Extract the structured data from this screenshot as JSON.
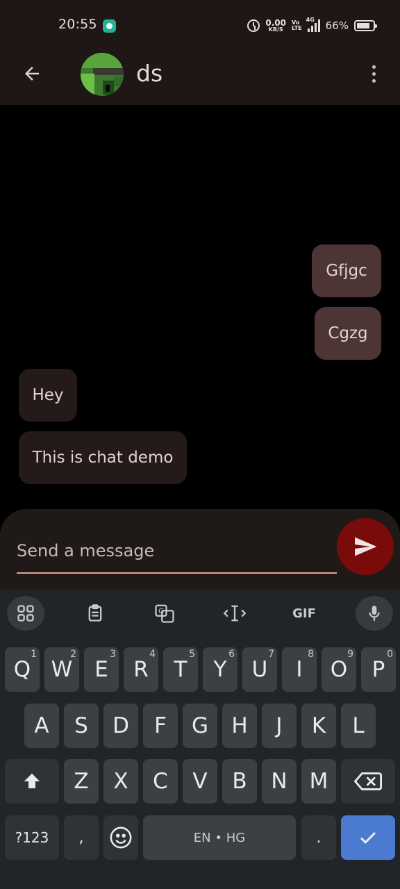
{
  "status_bar": {
    "time": "20:55",
    "net_speed_value": "0.00",
    "net_speed_unit": "KB/S",
    "volte_top": "Vo",
    "volte_bottom": "LTE",
    "network_type": "4G",
    "battery_percent": "66%",
    "battery_level": 0.66
  },
  "header": {
    "contact_name": "ds",
    "icons": [
      "arrow-back-icon",
      "pixel-avatar",
      "more-vert-icon"
    ]
  },
  "messages": [
    {
      "text": "Gfjgc",
      "direction": "outgoing"
    },
    {
      "text": "Cgzg",
      "direction": "outgoing"
    },
    {
      "text": "Hey",
      "direction": "incoming"
    },
    {
      "text": "This is chat demo",
      "direction": "incoming"
    }
  ],
  "composer": {
    "placeholder": "Send a message",
    "value": ""
  },
  "keyboard": {
    "toolbar": [
      "apps-grid-icon",
      "clipboard-icon",
      "translate-icon",
      "text-cursor-icon",
      "gif-icon",
      "mic-icon"
    ],
    "gif_label": "GIF",
    "row1": [
      {
        "k": "Q",
        "h": "1"
      },
      {
        "k": "W",
        "h": "2"
      },
      {
        "k": "E",
        "h": "3"
      },
      {
        "k": "R",
        "h": "4"
      },
      {
        "k": "T",
        "h": "5"
      },
      {
        "k": "Y",
        "h": "6"
      },
      {
        "k": "U",
        "h": "7"
      },
      {
        "k": "I",
        "h": "8"
      },
      {
        "k": "O",
        "h": "9"
      },
      {
        "k": "P",
        "h": "0"
      }
    ],
    "row2": [
      "A",
      "S",
      "D",
      "F",
      "G",
      "H",
      "J",
      "K",
      "L"
    ],
    "row3": [
      "Z",
      "X",
      "C",
      "V",
      "B",
      "N",
      "M"
    ],
    "symbols_label": "?123",
    "comma": ",",
    "space_label": "EN • HG",
    "period": "."
  },
  "colors": {
    "outgoing_bubble": "#4c3534",
    "incoming_bubble": "#231a19",
    "send_button": "#7a0b0b",
    "enter_key": "#4a7bd0",
    "input_underline": "#e3a29b"
  }
}
